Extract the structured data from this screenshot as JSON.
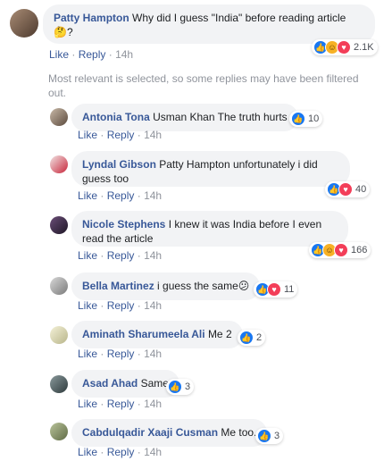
{
  "actions": {
    "like": "Like",
    "reply": "Reply",
    "sep": "·"
  },
  "top_comment": {
    "author": "Patty Hampton",
    "text": "Why did I guess \"India\" before reading article",
    "text2": "🤔?",
    "time": "14h",
    "reaction_count": "2.1K"
  },
  "filter_note": "Most relevant is selected, so some replies may have been filtered out.",
  "replies": [
    {
      "author": "Antonia Tona",
      "text": "Usman Khan The truth hurts",
      "time": "14h",
      "reaction_count": "10"
    },
    {
      "author": "Lyndal Gibson",
      "text": "Patty Hampton unfortunately i did guess too",
      "time": "14h",
      "reaction_count": "40"
    },
    {
      "author": "Nicole Stephens",
      "text": "I knew it was India before I even read the article",
      "time": "14h",
      "reaction_count": "166"
    },
    {
      "author": "Bella Martinez",
      "text": "i guess the same😕",
      "time": "14h",
      "reaction_count": "11"
    },
    {
      "author": "Aminath Sharumeela Ali",
      "text": "Me 2",
      "time": "14h",
      "reaction_count": "2"
    },
    {
      "author": "Asad Ahad",
      "text": "Same",
      "time": "14h",
      "reaction_count": "3"
    },
    {
      "author": "Cabdulqadir Xaaji Cusman",
      "text": "Me too.",
      "time": "14h",
      "reaction_count": "3"
    }
  ]
}
